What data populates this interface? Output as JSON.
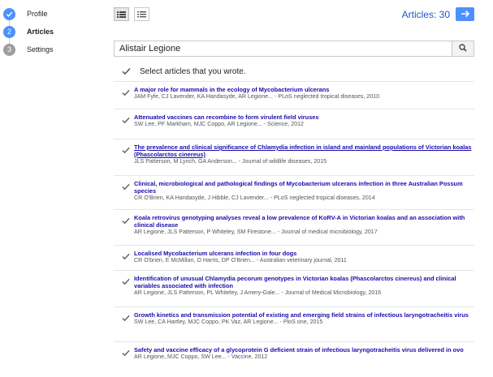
{
  "steps": [
    {
      "label": "Profile",
      "number": "",
      "state": "done"
    },
    {
      "label": "Articles",
      "number": "2",
      "state": "active"
    },
    {
      "label": "Settings",
      "number": "3",
      "state": "todo"
    }
  ],
  "toolbar": {
    "articles_label": "Articles: 30"
  },
  "search": {
    "value": "Alistair Legione"
  },
  "select_all": {
    "label": "Select articles that you wrote."
  },
  "articles": [
    {
      "title": "A major role for mammals in the ecology of Mycobacterium ulcerans",
      "meta": "JAM Fyfe, CJ Lavender, KA Handasyde, AR Legione... - PLoS neglected tropical diseases, 2010"
    },
    {
      "title": "Attenuated vaccines can recombine to form virulent field viruses",
      "meta": "SW Lee, PF Markham, MJC Coppo, AR Legione... - Science, 2012"
    },
    {
      "title": "The prevalence and clinical significance of Chlamydia infection in island and mainland populations of Victorian koalas (Phascolarctos cinereus)",
      "meta": "JLS Patterson, M Lynch, GA Anderson... - Journal of wildlife diseases, 2015",
      "underline": true
    },
    {
      "title": "Clinical, microbiological and pathological findings of Mycobacterium ulcerans infection in three Australian Possum species",
      "meta": "CR O'Brien, KA Handasyde, J Hibble, CJ Lavender... - PLoS neglected tropical diseases, 2014"
    },
    {
      "title": "Koala retrovirus genotyping analyses reveal a low prevalence of KoRV-A in Victorian koalas and an association with clinical disease",
      "meta": "AR Legione, JLS Patterson, P Whiteley, SM Firestone... - Journal of medical microbiology, 2017"
    },
    {
      "title": "Localised Mycobacterium ulcerans infection in four dogs",
      "meta": "CR O'brien, E McMillan, O Harris, DP O'Brien... - Australian veterinary journal, 2011"
    },
    {
      "title": "Identification of unusual Chlamydia pecorum genotypes in Victorian koalas (Phascolarctos cinereus) and clinical variables associated with infection",
      "meta": "AR Legione, JLS Patterson, PL Whiteley, J Amery-Gale... - Journal of Medical Microbiology, 2016"
    },
    {
      "title": "Growth kinetics and transmission potential of existing and emerging field strains of infectious laryngotracheitis virus",
      "meta": "SW Lee, CA Hartley, MJC Coppo, PK Vaz, AR Legione... - PloS one, 2015"
    },
    {
      "title": "Safety and vaccine efficacy of a glycoprotein G deficient strain of infectious laryngotracheitis virus delivered in ovo",
      "meta": "AR Legione, MJC Coppo, SW Lee... - Vaccine, 2012"
    }
  ]
}
